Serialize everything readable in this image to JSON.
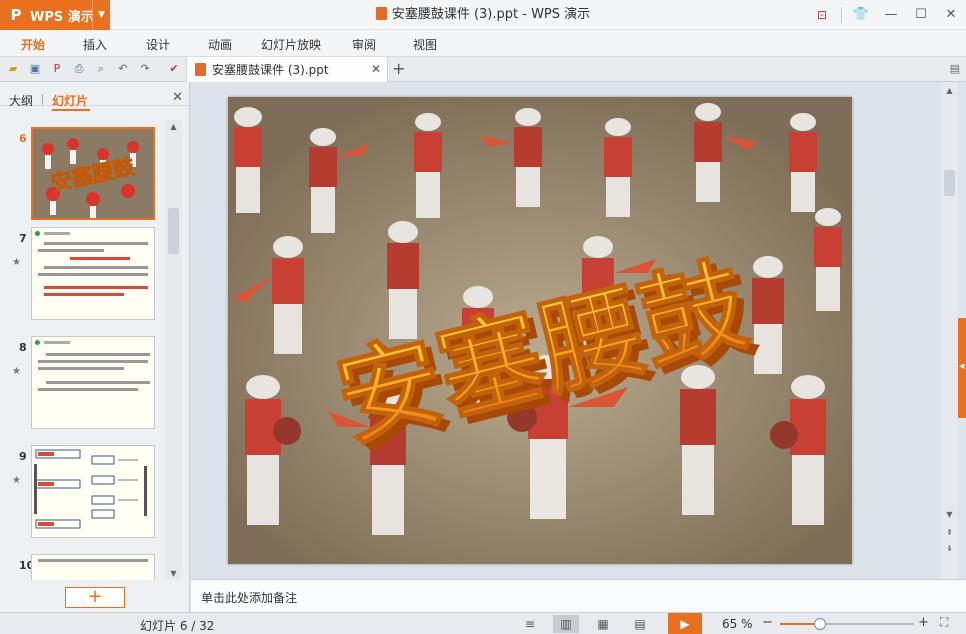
{
  "app": {
    "name": "WPS 演示",
    "logo": "P"
  },
  "window": {
    "title": "安塞腰鼓课件 (3).ppt - WPS 演示"
  },
  "menu": {
    "items": [
      {
        "label": "开始",
        "active": true
      },
      {
        "label": "插入",
        "active": false
      },
      {
        "label": "设计",
        "active": false
      },
      {
        "label": "动画",
        "active": false
      },
      {
        "label": "幻灯片放映",
        "active": false
      },
      {
        "label": "审阅",
        "active": false
      },
      {
        "label": "视图",
        "active": false
      }
    ]
  },
  "tab": {
    "label": "安塞腰鼓课件 (3).ppt"
  },
  "left_panel": {
    "tab_outline": "大纲",
    "tab_slides": "幻灯片",
    "slides": [
      {
        "num": "6",
        "active": true
      },
      {
        "num": "7",
        "active": false
      },
      {
        "num": "8",
        "active": false
      },
      {
        "num": "9",
        "active": false
      },
      {
        "num": "10",
        "active": false
      }
    ],
    "add_label": "+"
  },
  "slide": {
    "title": "安塞腰鼓"
  },
  "notes": {
    "placeholder": "单击此处添加备注"
  },
  "status": {
    "page_label": "幻灯片 6 / 32",
    "zoom_label": "65 %",
    "zoom_fraction": 0.3
  },
  "colors": {
    "accent": "#e8701e",
    "title_fill": "#f7a21b"
  }
}
